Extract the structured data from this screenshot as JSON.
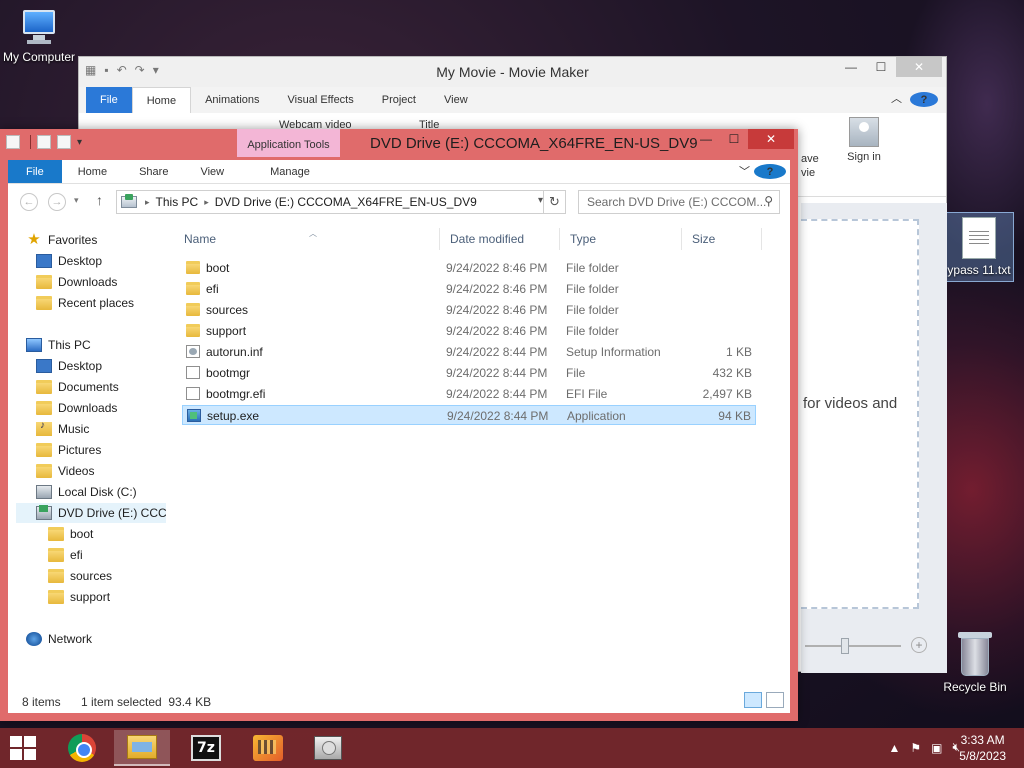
{
  "desktop": {
    "icons": [
      {
        "label": "My Computer"
      },
      {
        "label": "ypass 11.txt"
      },
      {
        "label": "Recycle Bin"
      }
    ]
  },
  "moviemaker": {
    "title": "My Movie - Movie Maker",
    "tabs": [
      "File",
      "Home",
      "Animations",
      "Visual Effects",
      "Project",
      "View"
    ],
    "ribbon_fragments": [
      "Webcam video",
      "Title",
      "ave",
      "vie"
    ],
    "sign_in": "Sign in",
    "sign_in_line2": "in",
    "hint_text": "for videos and"
  },
  "explorer": {
    "title": "DVD Drive (E:) CCCOMA_X64FRE_EN-US_DV9",
    "context_tab": "Application Tools",
    "tabs": [
      "File",
      "Home",
      "Share",
      "View",
      "Manage"
    ],
    "address": {
      "segments": [
        "This PC",
        "DVD Drive (E:) CCCOMA_X64FRE_EN-US_DV9"
      ]
    },
    "search_placeholder": "Search DVD Drive (E:) CCCOM...",
    "tree": [
      {
        "label": "Favorites",
        "icon": "star-icon"
      },
      {
        "label": "Desktop",
        "icon": "desktop-icon"
      },
      {
        "label": "Downloads",
        "icon": "downloads-folder-icon"
      },
      {
        "label": "Recent places",
        "icon": "recent-places-icon"
      },
      {
        "label": "This PC",
        "icon": "computer-icon"
      },
      {
        "label": "Desktop",
        "icon": "desktop-icon"
      },
      {
        "label": "Documents",
        "icon": "documents-folder-icon"
      },
      {
        "label": "Downloads",
        "icon": "downloads-folder-icon"
      },
      {
        "label": "Music",
        "icon": "music-folder-icon"
      },
      {
        "label": "Pictures",
        "icon": "pictures-folder-icon"
      },
      {
        "label": "Videos",
        "icon": "videos-folder-icon"
      },
      {
        "label": "Local Disk (C:)",
        "icon": "local-disk-icon"
      },
      {
        "label": "DVD Drive (E:) CCCC",
        "icon": "dvd-drive-icon"
      },
      {
        "label": "boot",
        "icon": "folder-icon"
      },
      {
        "label": "efi",
        "icon": "folder-icon"
      },
      {
        "label": "sources",
        "icon": "folder-icon"
      },
      {
        "label": "support",
        "icon": "folder-icon"
      },
      {
        "label": "Network",
        "icon": "network-icon"
      }
    ],
    "columns": [
      "Name",
      "Date modified",
      "Type",
      "Size"
    ],
    "files": [
      {
        "name": "boot",
        "date": "9/24/2022 8:46 PM",
        "type": "File folder",
        "size": "",
        "icon": "folder-icon"
      },
      {
        "name": "efi",
        "date": "9/24/2022 8:46 PM",
        "type": "File folder",
        "size": "",
        "icon": "folder-icon"
      },
      {
        "name": "sources",
        "date": "9/24/2022 8:46 PM",
        "type": "File folder",
        "size": "",
        "icon": "folder-icon"
      },
      {
        "name": "support",
        "date": "9/24/2022 8:46 PM",
        "type": "File folder",
        "size": "",
        "icon": "folder-icon"
      },
      {
        "name": "autorun.inf",
        "date": "9/24/2022 8:44 PM",
        "type": "Setup Information",
        "size": "1 KB",
        "icon": "setup-info-icon"
      },
      {
        "name": "bootmgr",
        "date": "9/24/2022 8:44 PM",
        "type": "File",
        "size": "432 KB",
        "icon": "file-icon"
      },
      {
        "name": "bootmgr.efi",
        "date": "9/24/2022 8:44 PM",
        "type": "EFI File",
        "size": "2,497 KB",
        "icon": "file-icon"
      },
      {
        "name": "setup.exe",
        "date": "9/24/2022 8:44 PM",
        "type": "Application",
        "size": "94 KB",
        "icon": "setup-exe-icon",
        "selected": true
      }
    ],
    "status": {
      "items": "8 items",
      "selected": "1 item selected  93.4 KB"
    }
  },
  "taskbar": {
    "apps": [
      "chrome-icon",
      "file-explorer-icon",
      "7zip-icon",
      "movie-maker-icon",
      "dvd-drive-icon"
    ],
    "time": "3:33 AM",
    "date": "5/8/2023"
  },
  "colors": {
    "explorer_frame": "#e06b6b",
    "file_tab_blue": "#1979ca",
    "selection": "#cde8ff",
    "app_tools_tab": "#f3b6d6",
    "taskbar": "#782d2d"
  }
}
